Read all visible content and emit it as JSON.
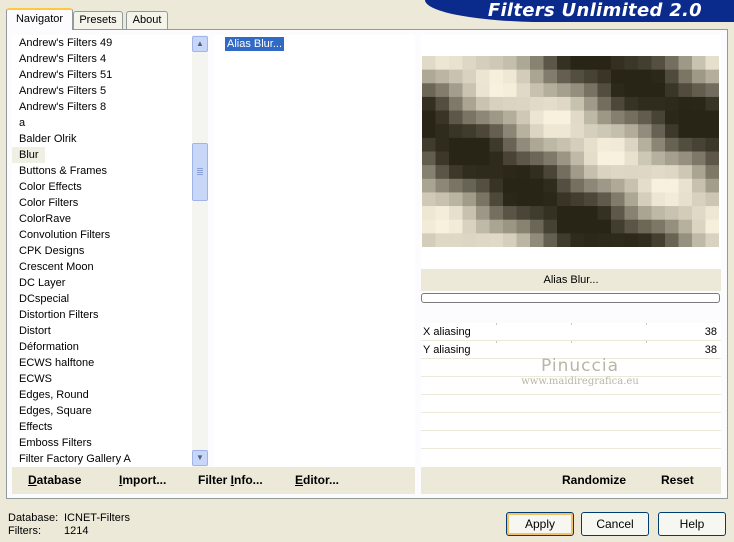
{
  "tabs": [
    {
      "label": "Navigator",
      "active": true
    },
    {
      "label": "Presets",
      "active": false
    },
    {
      "label": "About",
      "active": false
    }
  ],
  "title": "Filters Unlimited 2.0",
  "categories": [
    "Andrew's Filters 49",
    "Andrew's Filters 4",
    "Andrew's Filters 51",
    "Andrew's Filters 5",
    "Andrew's Filters 8",
    "a",
    "Balder Olrik",
    "Blur",
    "Buttons & Frames",
    "Color Effects",
    "Color Filters",
    "ColorRave",
    "Convolution Filters",
    "CPK Designs",
    "Crescent Moon",
    "DC Layer",
    "DCspecial",
    "Distortion Filters",
    "Distort",
    "Déformation",
    "ECWS halftone",
    "ECWS",
    "Edges, Round",
    "Edges, Square",
    "Effects",
    "Emboss Filters",
    "Filter Factory Gallery A"
  ],
  "selected_category": "Blur",
  "filters": [
    "Alias Blur..."
  ],
  "selected_filter": "Alias Blur...",
  "left_buttons": {
    "database": "Database",
    "import": "Import...",
    "filter_info": "Filter Info...",
    "editor": "Editor..."
  },
  "right_buttons": {
    "randomize": "Randomize",
    "reset": "Reset"
  },
  "preview_filter_name": "Alias Blur...",
  "params": [
    {
      "label": "X aliasing",
      "value": "38"
    },
    {
      "label": "Y aliasing",
      "value": "38"
    }
  ],
  "watermark": {
    "line1": "Pinuccia",
    "line2": "www.maidiregrafica.eu"
  },
  "status": {
    "database_label": "Database:",
    "database_value": "ICNET-Filters",
    "filters_label": "Filters:",
    "filters_value": "1214"
  },
  "dialog_buttons": {
    "apply": "Apply",
    "cancel": "Cancel",
    "help": "Help"
  },
  "colors": {
    "banner": "#0a2a8c",
    "selection": "#316ac5",
    "dialog_bg": "#ece9d8"
  }
}
